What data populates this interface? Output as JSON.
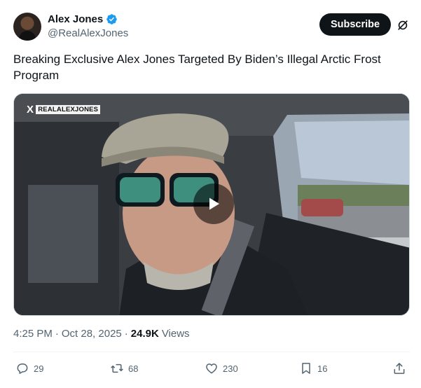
{
  "author": {
    "name": "Alex Jones",
    "handle": "@RealAlexJones",
    "verified": true
  },
  "header": {
    "subscribe_label": "Subscribe",
    "grok_icon": "grok-slash-icon"
  },
  "tweet": {
    "text": "Breaking Exclusive Alex Jones Targeted By Biden’s Illegal Arctic Frost Program"
  },
  "media": {
    "watermark_text": "REALALEXJONES",
    "watermark_mark": "X",
    "play_icon": "play-icon"
  },
  "meta": {
    "time": "4:25 PM",
    "separator": "·",
    "date": "Oct 28, 2025",
    "views_count": "24.9K",
    "views_label": "Views"
  },
  "actions": {
    "replies": "29",
    "reposts": "68",
    "likes": "230",
    "bookmarks": "16"
  },
  "colors": {
    "text_primary": "#0f1419",
    "text_secondary": "#536471",
    "verified_blue": "#1d9bf0",
    "button_dark": "#0f1419"
  }
}
